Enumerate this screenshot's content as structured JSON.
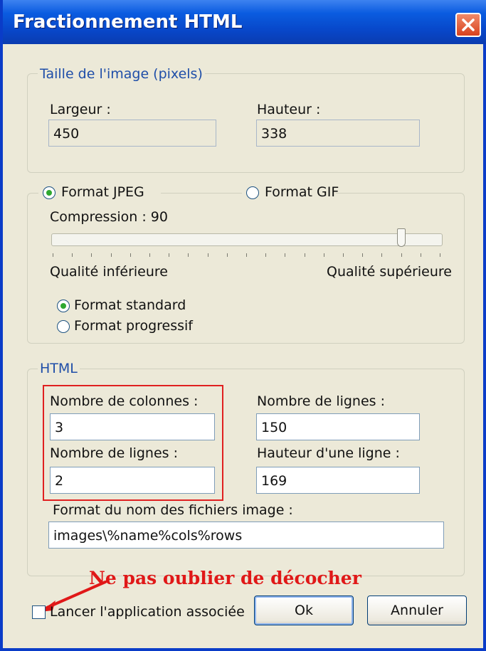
{
  "window": {
    "title": "Fractionnement HTML"
  },
  "image_size": {
    "legend": "Taille de l'image (pixels)",
    "width_label": "Largeur :",
    "width_value": "450",
    "height_label": "Hauteur :",
    "height_value": "338"
  },
  "format": {
    "jpeg_label": "Format JPEG",
    "jpeg_selected": true,
    "gif_label": "Format GIF",
    "gif_selected": false,
    "compression_label": "Compression : 90",
    "compression_level": 90,
    "quality_low_label": "Qualité inférieure",
    "quality_high_label": "Qualité supérieure",
    "standard_label": "Format standard",
    "standard_selected": true,
    "progressive_label": "Format progressif",
    "progressive_selected": false
  },
  "html": {
    "legend": "HTML",
    "columns_label": "Nombre de colonnes :",
    "columns_value": "3",
    "rows_label": "Nombre de lignes :",
    "rows_value": "2",
    "line_count_label": "Nombre de lignes :",
    "line_count_value": "150",
    "line_height_label": "Hauteur d'une ligne :",
    "line_height_value": "169",
    "filename_format_label": "Format du nom des fichiers image :",
    "filename_format_value": "images\\%name%cols%rows"
  },
  "footer": {
    "launch_app_label": "Lancer l'application associée",
    "launch_app_checked": false,
    "ok_label": "Ok",
    "cancel_label": "Annuler"
  },
  "annotation": {
    "text": "Ne pas oublier de décocher",
    "color": "#e01818"
  },
  "colors": {
    "titlebar": "#0a5ce0",
    "accent_legend": "#1f4ea8",
    "dialog_bg": "#ece9d8"
  }
}
